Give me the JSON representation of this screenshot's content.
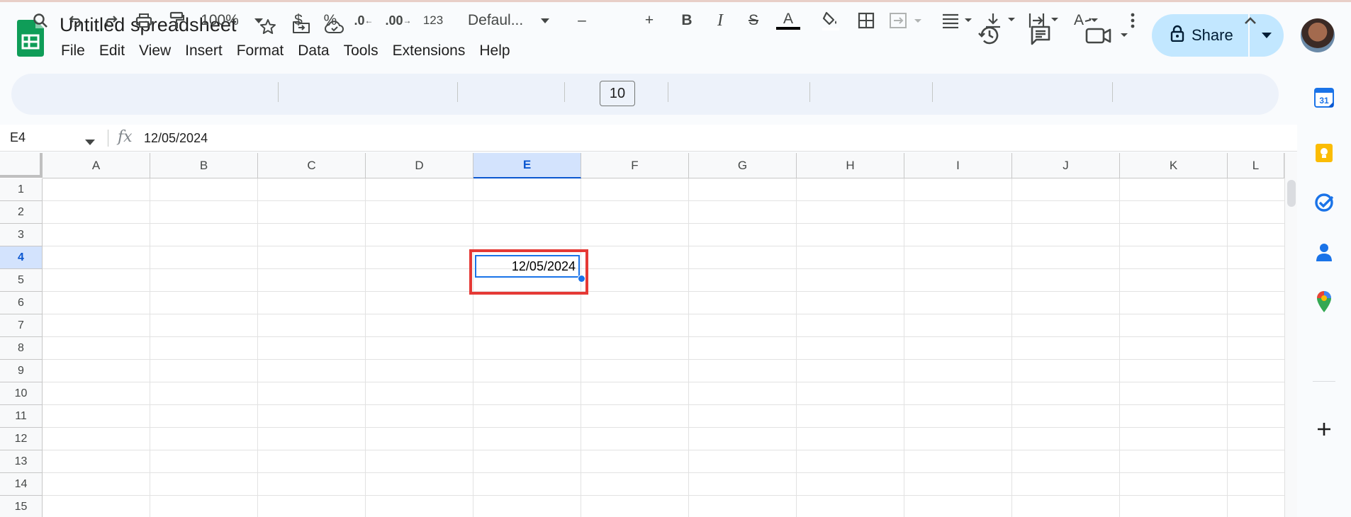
{
  "app": {
    "title": "Untitled spreadsheet",
    "menu": [
      "File",
      "Edit",
      "View",
      "Insert",
      "Format",
      "Data",
      "Tools",
      "Extensions",
      "Help"
    ],
    "share_label": "Share"
  },
  "toolbar": {
    "zoom": "100%",
    "currency": "$",
    "percent": "%",
    "dec_decrease": ".0",
    "dec_increase": ".00",
    "number_format": "123",
    "font": "Defaul...",
    "font_size": "10",
    "minus": "–",
    "plus": "+",
    "bold": "B",
    "italic": "I",
    "strike": "S",
    "text_color_letter": "A",
    "text_rotation_letter": "A"
  },
  "formula_bar": {
    "name_box": "E4",
    "fx": "fx",
    "value": "12/05/2024"
  },
  "sheet": {
    "columns": [
      "A",
      "B",
      "C",
      "D",
      "E",
      "F",
      "G",
      "H",
      "I",
      "J",
      "K",
      "L"
    ],
    "rows": [
      "1",
      "2",
      "3",
      "4",
      "5",
      "6",
      "7",
      "8",
      "9",
      "10",
      "11",
      "12",
      "13",
      "14",
      "15"
    ],
    "selected_column": "E",
    "selected_row": "4",
    "cell_E4": "12/05/2024"
  },
  "side_panel": {
    "calendar_day": "31"
  },
  "colors": {
    "accent": "#1a73e8",
    "share_bg": "#c2e7ff",
    "highlight": "#e53935",
    "sheets_green": "#0f9d58"
  }
}
